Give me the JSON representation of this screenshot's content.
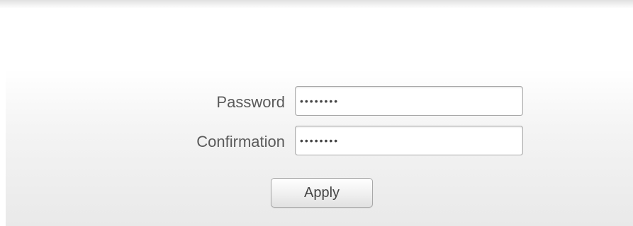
{
  "form": {
    "password": {
      "label": "Password",
      "value": "secret12"
    },
    "confirmation": {
      "label": "Confirmation",
      "value": "secret12"
    },
    "apply_label": "Apply"
  }
}
